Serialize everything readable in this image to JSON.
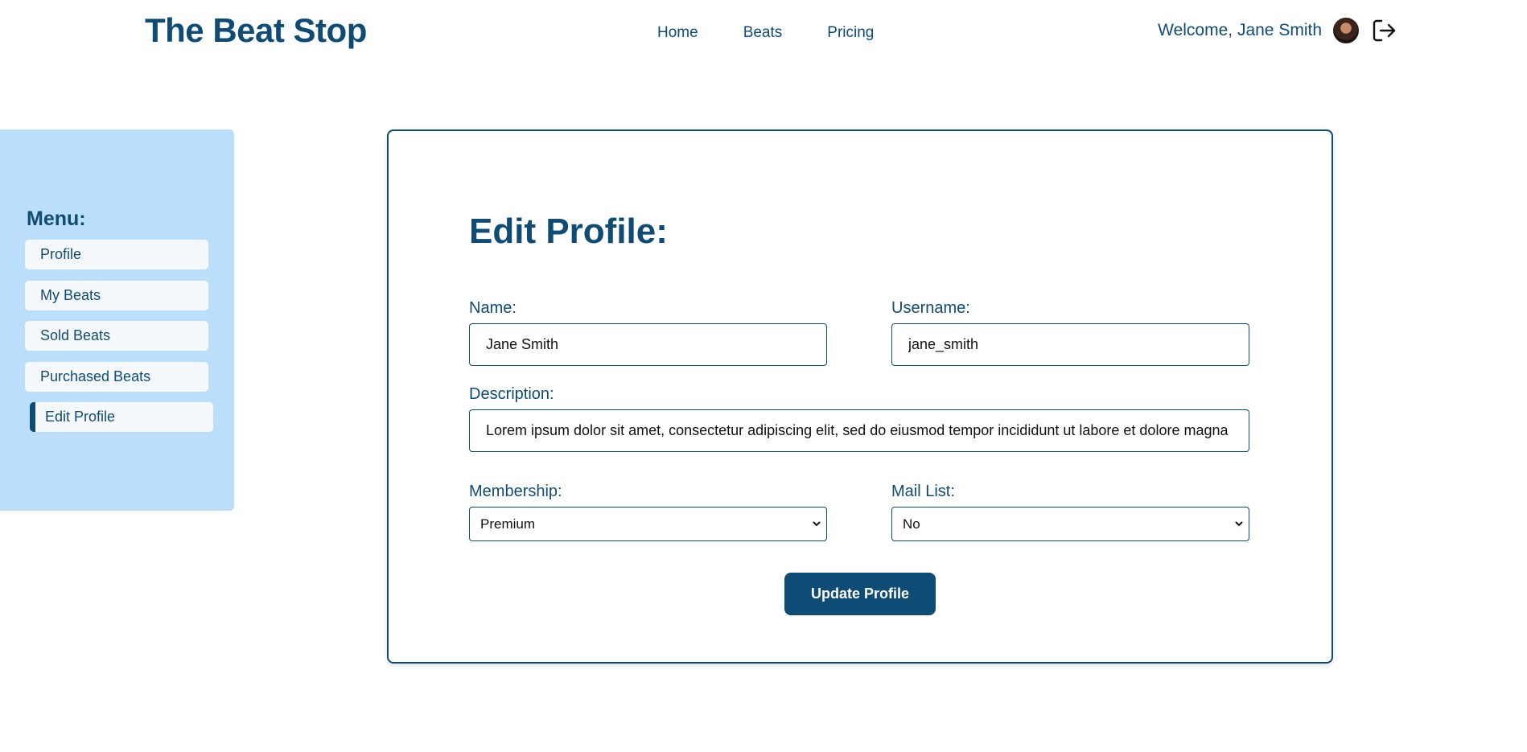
{
  "header": {
    "logo": "The Beat Stop",
    "nav": [
      "Home",
      "Beats",
      "Pricing"
    ],
    "welcome": "Welcome, Jane Smith"
  },
  "sidebar": {
    "title": "Menu:",
    "items": [
      {
        "label": "Profile"
      },
      {
        "label": "My Beats"
      },
      {
        "label": "Sold Beats"
      },
      {
        "label": "Purchased Beats"
      },
      {
        "label": "Edit Profile",
        "active": true
      }
    ]
  },
  "form": {
    "title": "Edit Profile:",
    "name_label": "Name:",
    "name_value": "Jane Smith",
    "username_label": "Username:",
    "username_value": "jane_smith",
    "description_label": "Description:",
    "description_value": "Lorem ipsum dolor sit amet, consectetur adipiscing elit, sed do eiusmod tempor incididunt ut labore et dolore magna aliqua.",
    "membership_label": "Membership:",
    "membership_value": "Premium",
    "mail_list_label": "Mail List:",
    "mail_list_value": "No",
    "submit_label": "Update Profile"
  },
  "colors": {
    "brand": "#0f4c75",
    "sidebar_bg": "#bbdffa",
    "menu_item_bg": "#f6f9fc"
  },
  "icons": {
    "avatar": "user-avatar",
    "logout": "logout-icon",
    "select": "chevron-down-icon"
  }
}
